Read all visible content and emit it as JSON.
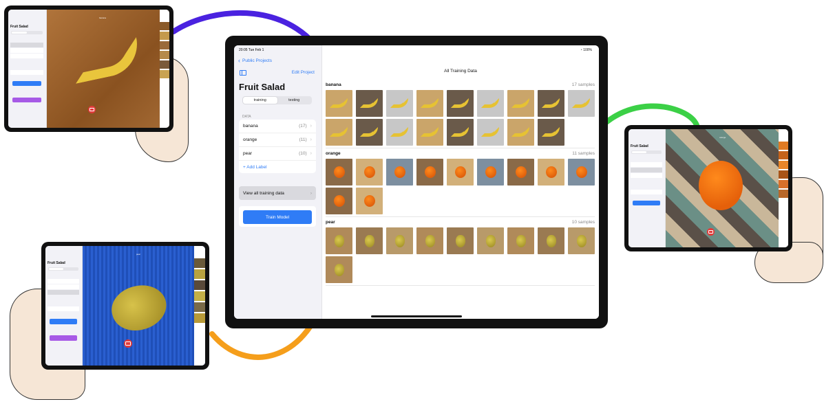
{
  "colors": {
    "accent": "#2f7cf6",
    "arrow_top": "#4a22e0",
    "arrow_right": "#3bd046",
    "arrow_bottom": "#f59e1b"
  },
  "status": {
    "time": "20:05  Tue Feb 1",
    "battery": "100%"
  },
  "sidebar": {
    "back_label": "Public Projects",
    "edit_label": "Edit Project",
    "project_title": "Fruit Salad",
    "segments": [
      "training",
      "testing"
    ],
    "data_header": "DATA",
    "labels": [
      {
        "name": "banana",
        "count": "(17)"
      },
      {
        "name": "orange",
        "count": "(11)"
      },
      {
        "name": "pear",
        "count": "(10)"
      }
    ],
    "add_label": "+ Add Label",
    "view_all": "View all training data",
    "train_button": "Train Model"
  },
  "main": {
    "title": "All Training Data",
    "sections": [
      {
        "name": "banana",
        "count_label": "17 samples",
        "count": 17,
        "fruit": "banana"
      },
      {
        "name": "orange",
        "count_label": "11 samples",
        "count": 11,
        "fruit": "orange"
      },
      {
        "name": "pear",
        "count_label": "10 samples",
        "count": 10,
        "fruit": "pear"
      }
    ]
  },
  "left_top_device": {
    "project_title": "Fruit Salad",
    "view_title": "banana",
    "train_button": "Train Model",
    "record_button": "Play Game"
  },
  "right_device": {
    "project_title": "Fruit Salad",
    "view_title": "orange",
    "train_button": "Train Model"
  },
  "left_bottom_device": {
    "project_title": "Fruit Salad",
    "view_title": "pear"
  }
}
